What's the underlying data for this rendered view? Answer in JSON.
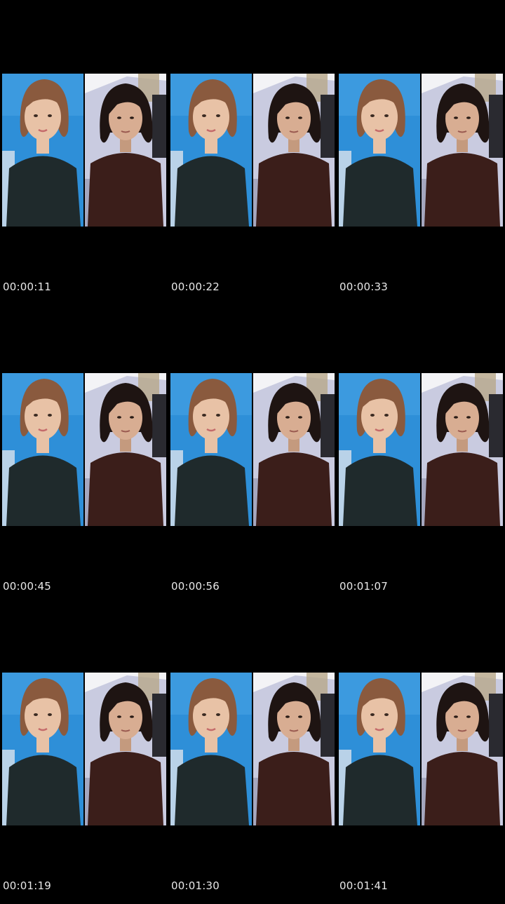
{
  "thumbnails": [
    {
      "time": "00:00:11"
    },
    {
      "time": "00:00:22"
    },
    {
      "time": "00:00:33"
    },
    {
      "time": "00:00:45"
    },
    {
      "time": "00:00:56"
    },
    {
      "time": "00:01:07"
    },
    {
      "time": "00:01:19"
    },
    {
      "time": "00:01:30"
    },
    {
      "time": "00:01:41"
    }
  ],
  "colors": {
    "background": "#000000",
    "timestamp_text": "#e8e8e8",
    "left_wall": "#2e8fd8",
    "left_shirt": "#1f2a2c",
    "left_hair": "#8a5a3e",
    "right_wall": "#c9cbe0",
    "right_shirt": "#3b1e1a",
    "right_hair": "#1e1412",
    "skin": "#e8c2a6"
  }
}
